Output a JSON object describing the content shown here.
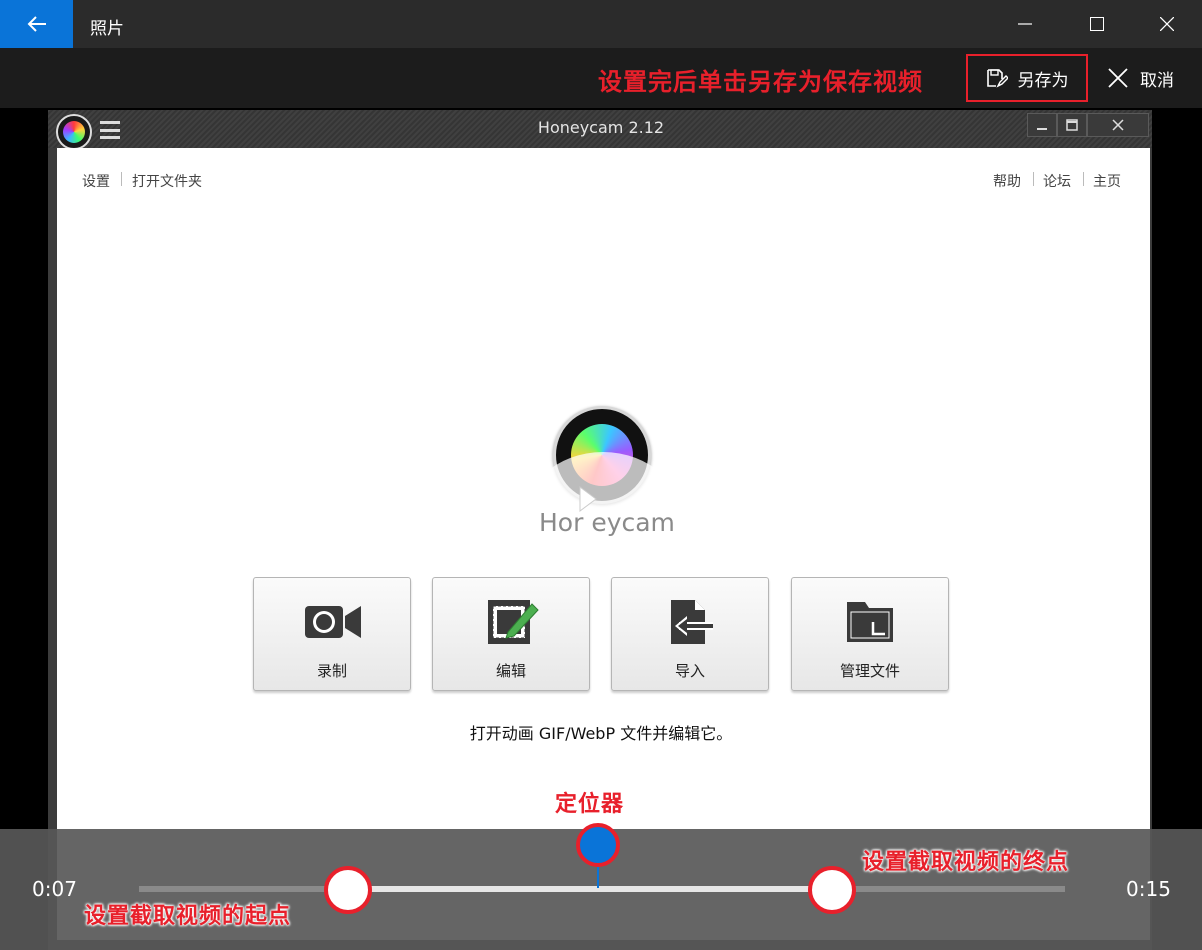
{
  "window": {
    "title": "照片",
    "back_icon": "back-arrow-icon",
    "controls": [
      "minimize-icon",
      "maximize-icon",
      "close-icon"
    ]
  },
  "toolbar": {
    "annotation": "设置完后单击另存为保存视频",
    "save_as_label": "另存为",
    "save_as_icon": "save-as-icon",
    "cancel_label": "取消",
    "cancel_icon": "close-icon",
    "annotation_color": "#e8202b"
  },
  "honeycam": {
    "title": "Honeycam 2.12",
    "links_left": [
      "设置",
      "打开文件夹"
    ],
    "links_right": [
      "帮助",
      "论坛",
      "主页"
    ],
    "brand": "Hor eycam",
    "buttons": [
      {
        "label": "录制",
        "icon": "video-camera-icon"
      },
      {
        "label": "编辑",
        "icon": "edit-image-icon"
      },
      {
        "label": "导入",
        "icon": "import-file-icon"
      },
      {
        "label": "管理文件",
        "icon": "folder-icon"
      }
    ],
    "hint": "打开动画 GIF/WebP 文件并编辑它。"
  },
  "timeline": {
    "start_time": "0:07",
    "end_time": "0:15",
    "playhead_annotation": "定位器",
    "start_annotation": "设置截取视频的起点",
    "end_annotation": "设置截取视频的终点",
    "accent_color": "#0a74d8"
  }
}
